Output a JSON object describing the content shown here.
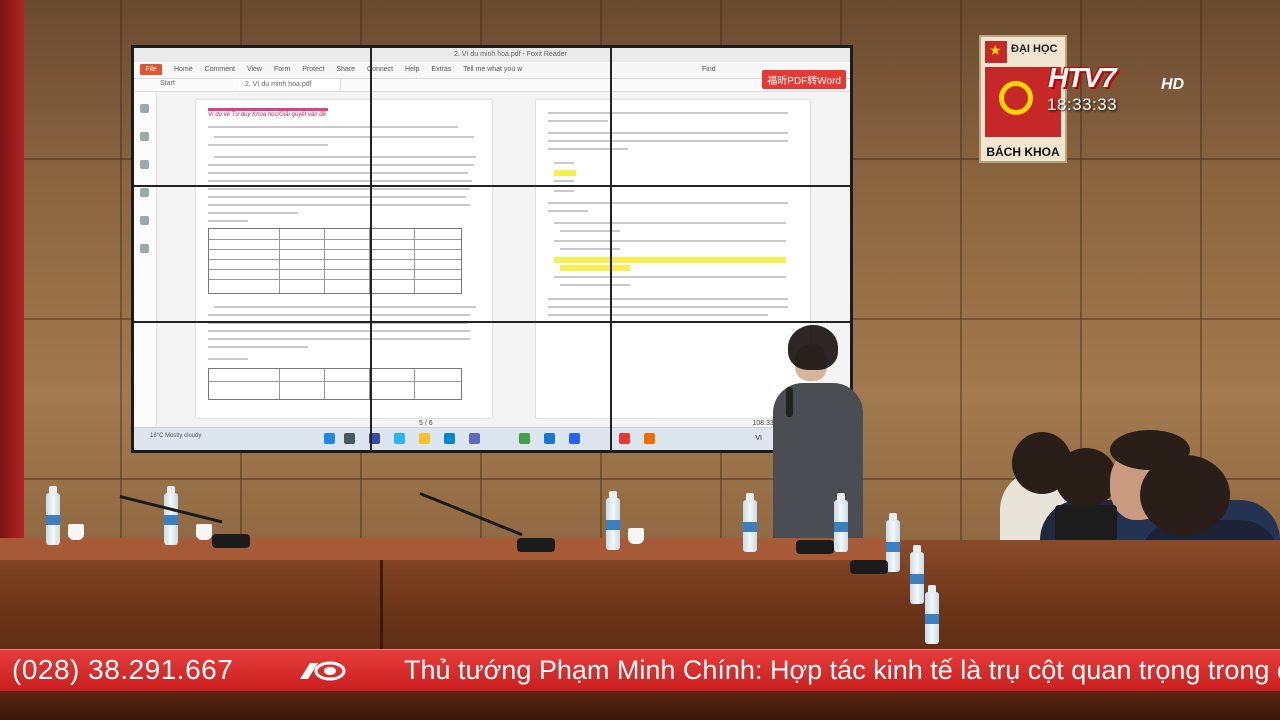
{
  "screen": {
    "window_title": "2. Ví du minh hoa.pdf - Foxit Reader",
    "menu_file": "File",
    "menu_tabs": [
      "Home",
      "Comment",
      "View",
      "Form",
      "Protect",
      "Share",
      "Connect",
      "Help",
      "Extras"
    ],
    "tell_me": "Tell me what you w",
    "find": "Find",
    "tab_start": "Start",
    "tab_doc": "2. Ví du minh hoa.pdf",
    "promo": "福昕PDF转Word",
    "left_heading": "Ví dụ về Tư duy Khoa học/Giải quyết vấn đề",
    "pager": "5 / 6",
    "zoom": "108.33%",
    "taskbar_weather": "Mostly cloudy",
    "taskbar_temp": "18°C",
    "taskbar_lang": "VI"
  },
  "logo": {
    "top": "ĐẠI HỌC",
    "bottom": "BÁCH KHOA"
  },
  "channel": {
    "name": "HTV7",
    "suffix": "HD",
    "clock": "18:33:33"
  },
  "ticker": {
    "phone": "(028) 38.291.667",
    "headline": "Thủ tướng Phạm Minh Chính: Hợp tác kinh tế là trụ cột quan trọng trong q"
  }
}
